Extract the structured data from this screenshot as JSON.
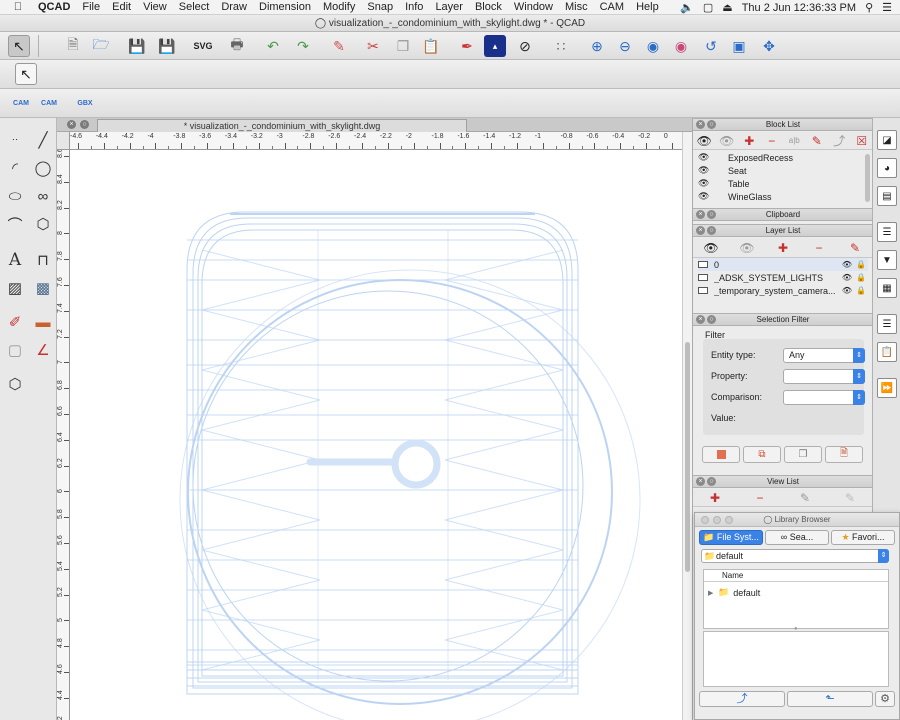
{
  "menubar": {
    "app_name": "QCAD",
    "items": [
      "File",
      "Edit",
      "View",
      "Select",
      "Draw",
      "Dimension",
      "Modify",
      "Snap",
      "Info",
      "Layer",
      "Block",
      "Window",
      "Misc",
      "CAM",
      "Help"
    ],
    "clock": "Thu 2 Jun  12:36:33 PM"
  },
  "window": {
    "title": "visualization_-_condominium_with_skylight.dwg * - QCAD"
  },
  "toolbar3": {
    "cam1": "CAM",
    "cam2": "CAM",
    "gbx": "GBX"
  },
  "document": {
    "tab_title": "* visualization_-_condominium_with_skylight.dwg"
  },
  "rulers": {
    "h_ticks": [
      "-4.6",
      "-4.4",
      "-4.2",
      "-4",
      "-3.8",
      "-3.6",
      "-3.4",
      "-3.2",
      "-3",
      "-2.8",
      "-2.6",
      "-2.4",
      "-2.2",
      "-2",
      "-1.8",
      "-1.6",
      "-1.4",
      "-1.2",
      "-1",
      "-0.8",
      "-0.6",
      "-0.4",
      "-0.2",
      "0"
    ],
    "v_ticks": [
      "8.6",
      "8.4",
      "8.2",
      "8",
      "7.8",
      "7.6",
      "7.4",
      "7.2",
      "7",
      "6.8",
      "6.6",
      "6.4",
      "6.2",
      "6",
      "5.8",
      "5.6",
      "5.4",
      "5.2",
      "5",
      "4.8",
      "4.6",
      "4.4",
      "4.2"
    ]
  },
  "block_list": {
    "title": "Block List",
    "items": [
      "ExposedRecess",
      "Seat",
      "Table",
      "WineGlass"
    ]
  },
  "clipboard": {
    "title": "Clipboard"
  },
  "layer_list": {
    "title": "Layer List",
    "layers": [
      "0",
      "_ADSK_SYSTEM_LIGHTS",
      "_temporary_system_camera..."
    ]
  },
  "selection_filter": {
    "title": "Selection Filter",
    "group_label": "Filter",
    "entity_type_label": "Entity type:",
    "entity_type_value": "Any",
    "property_label": "Property:",
    "comparison_label": "Comparison:",
    "value_label": "Value:"
  },
  "view_list": {
    "title": "View List"
  },
  "library_browser": {
    "title": "Library Browser",
    "tabs": [
      "File Syst...",
      "Sea...",
      "Favori..."
    ],
    "location": "default",
    "column_name": "Name",
    "tree_item": "default"
  },
  "colors": {
    "drawing_stroke": "#bcd4f2",
    "accent_blue": "#3b82e6"
  }
}
